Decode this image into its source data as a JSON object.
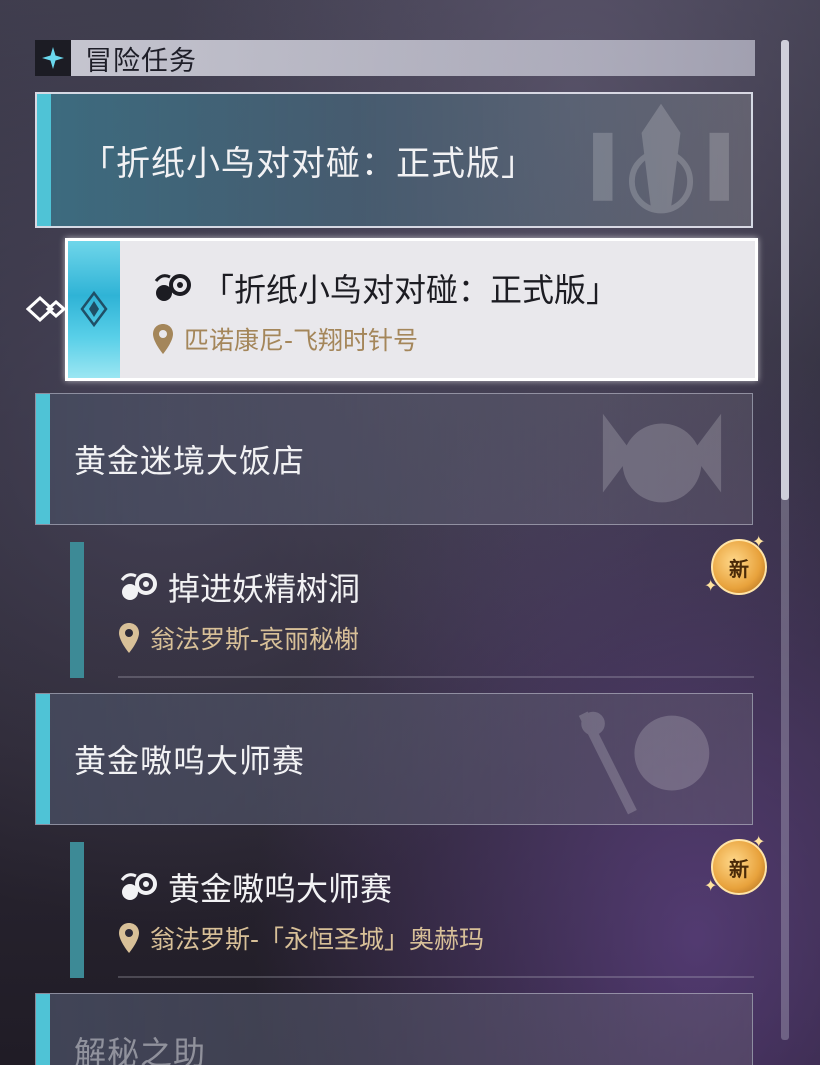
{
  "section": {
    "title": "冒险任务",
    "icon": "sparkle-star-icon"
  },
  "categories": [
    {
      "label": "「折纸小鸟对对碰：正式版」",
      "active": true
    },
    {
      "label": "黄金迷境大饭店"
    },
    {
      "label": "黄金嗷呜大师赛"
    },
    {
      "label": "解秘之助"
    }
  ],
  "quests": [
    {
      "name": "「折纸小鸟对对碰：正式版」",
      "location": "匹诺康尼-飞翔时针号",
      "icon": "adventure-quest-icon",
      "selected": true
    },
    {
      "name": "掉进妖精树洞",
      "location": "翁法罗斯-哀丽秘榭",
      "icon": "adventure-quest-icon",
      "badge": "新"
    },
    {
      "name": "黄金嗷呜大师赛",
      "location": "翁法罗斯-「永恒圣城」奥赫玛",
      "icon": "adventure-quest-icon",
      "badge": "新"
    }
  ],
  "colors": {
    "accent": "#4fc3d6",
    "quest_bar": "#3d8a96",
    "location_text": "#d8c098",
    "badge": "#e8a23c"
  }
}
